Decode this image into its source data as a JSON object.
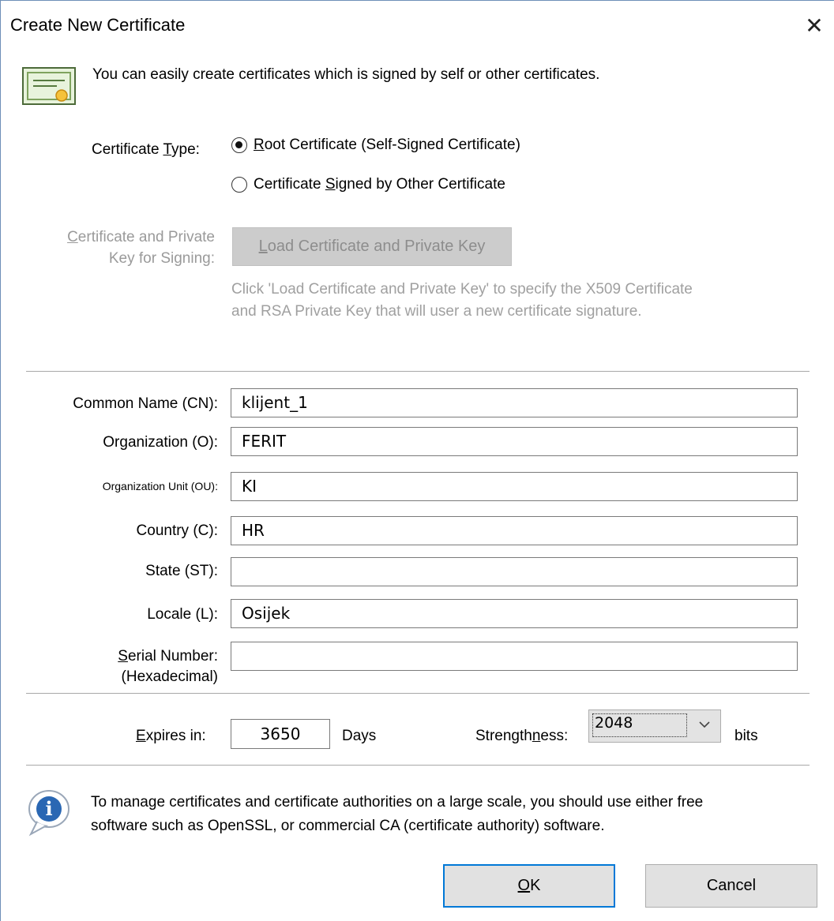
{
  "window": {
    "title": "Create New Certificate",
    "close_glyph": "✕"
  },
  "intro_text": "You can easily create certificates which is signed by self or other certificates.",
  "certificate_type": {
    "label_pre": "Certificate ",
    "label_ul": "T",
    "label_post": "ype:",
    "options": [
      {
        "pre": "",
        "ul": "R",
        "post": "oot Certificate (Self-Signed Certificate)",
        "checked": true
      },
      {
        "pre": "Certificate ",
        "ul": "S",
        "post": "igned by Other Certificate",
        "checked": false
      }
    ]
  },
  "signing": {
    "label_line1_ul": "C",
    "label_line1_rest": "ertificate and Private",
    "label_line2": "Key for Signing:",
    "button_ul": "L",
    "button_rest": "oad Certificate and Private Key",
    "hint_line1": "Click 'Load Certificate and Private Key' to specify the X509 Certificate",
    "hint_line2": "and RSA Private Key that will user a new certificate signature."
  },
  "fields": {
    "common_name": {
      "label": "Common Name (CN):",
      "value": "klijent_1"
    },
    "organization": {
      "label": "Organization (O):",
      "value": "FERIT"
    },
    "org_unit": {
      "label": "Organization Unit (OU):",
      "value": "KI"
    },
    "country": {
      "label": "Country (C):",
      "value": "HR"
    },
    "state": {
      "label": "State (ST):",
      "value": ""
    },
    "locale": {
      "label": "Locale (L):",
      "value": "Osijek"
    },
    "serial": {
      "label_ul": "S",
      "label_rest": "erial Number:",
      "label_line2": "(Hexadecimal)",
      "value": ""
    }
  },
  "expiry": {
    "label_ul": "E",
    "label_rest": "xpires in:",
    "value": "3650",
    "unit": "Days"
  },
  "strength": {
    "label_pre": "Strength",
    "label_ul": "n",
    "label_post": "ess:",
    "value": "2048",
    "unit": "bits"
  },
  "info_text_line1": "To manage certificates and certificate authorities on a large scale, you should use either free",
  "info_text_line2": "software such as OpenSSL, or commercial CA (certificate authority) software.",
  "buttons": {
    "ok_ul": "O",
    "ok_rest": "K",
    "cancel": "Cancel"
  },
  "colors": {
    "accent": "#0078d7",
    "disabled_text": "#9a9a9a"
  }
}
